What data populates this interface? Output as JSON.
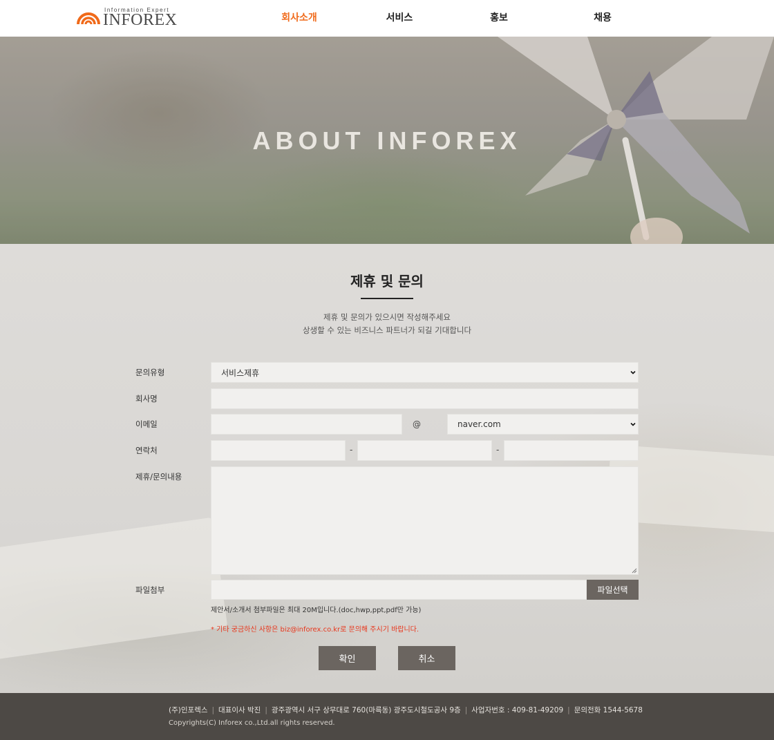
{
  "header": {
    "logo_tagline": "Information Expert",
    "logo_name": "INFOREX",
    "nav": [
      "회사소개",
      "서비스",
      "홍보",
      "채용"
    ],
    "active_nav": "회사소개"
  },
  "hero": {
    "title": "ABOUT INFOREX"
  },
  "section": {
    "title": "제휴 및 문의",
    "desc_line1": "제휴 및 문의가 있으시면 작성해주세요",
    "desc_line2": "상생할 수 있는 비즈니스 파트너가 되길 기대합니다"
  },
  "form": {
    "type_label": "문의유형",
    "type_value": "서비스제휴",
    "company_label": "회사명",
    "company_value": "",
    "email_label": "이메일",
    "email_local": "",
    "email_at": "@",
    "email_domain": "naver.com",
    "phone_label": "연락처",
    "phone_sep": "-",
    "phone1": "",
    "phone2": "",
    "phone3": "",
    "content_label": "제휴/문의내용",
    "content_value": "",
    "file_label": "파일첨부",
    "file_value": "",
    "file_button": "파일선택",
    "file_note": "제안서/소개서 첨부파일은 최대 20M입니다.(doc,hwp,ppt,pdf만 가능)",
    "warning": "* 기타 궁금하신 사항은 biz@inforex.co.kr로 문의해 주시기 바랍니다.",
    "confirm_button": "확인",
    "cancel_button": "취소"
  },
  "footer": {
    "company": "(주)인포렉스",
    "ceo": "대표이사 박진",
    "address": "광주광역시 서구 상무대로 760(마륵동) 광주도시철도공사 9층",
    "business_no": "사업자번호 : 409-81-49209",
    "phone": "문의전화 1544-5678",
    "copyright": "Copyrights(C) Inforex co.,Ltd.all rights reserved."
  },
  "colors": {
    "accent": "#f06a1a",
    "button": "#6b6560",
    "footer_bg": "#4d4945",
    "warning": "#e8361c"
  }
}
